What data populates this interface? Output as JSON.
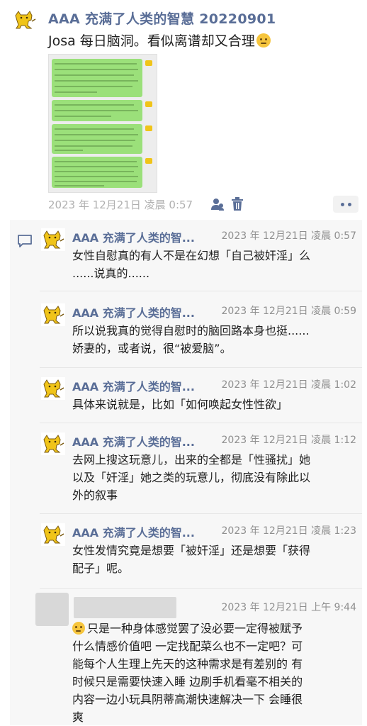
{
  "post": {
    "author": "AAA 充满了人类的智慧 20220901",
    "text": "Josa 每日脑洞。看似离谱却又合理",
    "time": "2023 年 12月21日 凌晨 0:57",
    "avatar_icon": "golden-bear-avatar-icon",
    "screenshot_icon": "chat-screenshot-thumbnail"
  },
  "comments": [
    {
      "author": "AAA 充满了人类的智...",
      "time": "2023 年 12月21日 凌晨 0:57",
      "lines": [
        "女性自慰真的有人不是在幻想「自己被奸淫」么",
        "......说真的......"
      ]
    },
    {
      "author": "AAA 充满了人类的智...",
      "time": "2023 年 12月21日 凌晨 0:59",
      "lines": [
        "所以说我真的觉得自慰时的脑回路本身也挺......",
        "娇妻的，或者说，很“被爱脑”。"
      ]
    },
    {
      "author": "AAA 充满了人类的智...",
      "time": "2023 年 12月21日 凌晨 1:02",
      "lines": [
        "具体来说就是，比如「如何唤起女性性欲」"
      ]
    },
    {
      "author": "AAA 充满了人类的智...",
      "time": "2023 年 12月21日 凌晨 1:12",
      "lines": [
        "去网上搜这玩意儿，出来的全都是「性骚扰」她",
        "以及「奸淫」她之类的玩意儿，彻底没有除此以",
        "外的叙事"
      ]
    },
    {
      "author": "AAA 充满了人类的智...",
      "time": "2023 年 12月21日 凌晨 1:23",
      "lines": [
        "女性发情究竟是想要「被奸淫」还是想要「获得",
        "配子」呢。"
      ]
    },
    {
      "author": "",
      "time": "2023 年 12月21日 上午 9:44",
      "lines": [
        "只是一种身体感觉罢了没必要一定得被赋予",
        "什么情感价值吧 一定找配菜么也不一定吧？可",
        "能每个人生理上先天的这种需求是有差别的 有",
        "时候只是需要快速入睡 边刷手机看毫不相关的",
        "内容一边小玩具阴蒂高潮快速解决一下 会睡很",
        "爽"
      ]
    }
  ],
  "icons": {
    "emoji": "thinking-face-icon",
    "visibility": "people-icon",
    "delete": "trash-icon",
    "more": "more-dots-icon",
    "comment": "comment-bubble-icon"
  }
}
